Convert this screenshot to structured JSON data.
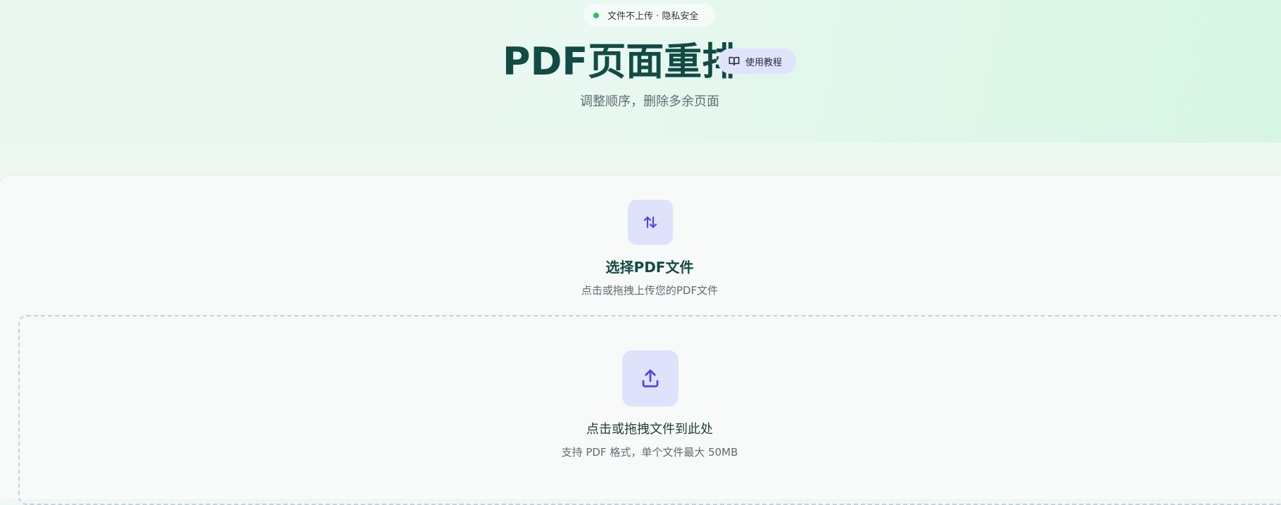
{
  "header": {
    "privacy_badge": "文件不上传 · 隐私安全",
    "title": "PDF页面重排",
    "tutorial_button": "使用教程",
    "subtitle": "调整顺序，删除多余页面"
  },
  "upload_section": {
    "title": "选择PDF文件",
    "subtitle": "点击或拖拽上传您的PDF文件",
    "dropzone_title": "点击或拖拽文件到此处",
    "dropzone_hint": "支持 PDF 格式，单个文件最大 50MB"
  },
  "icons": {
    "privacy": "status-dot",
    "tutorial": "book-open-icon",
    "reorder": "arrows-up-down-icon",
    "upload": "upload-icon"
  },
  "colors": {
    "title": "#124b43",
    "accent": "#4f46e5",
    "accent_bg": "#dfe2fb",
    "status_green": "#22c55e"
  }
}
